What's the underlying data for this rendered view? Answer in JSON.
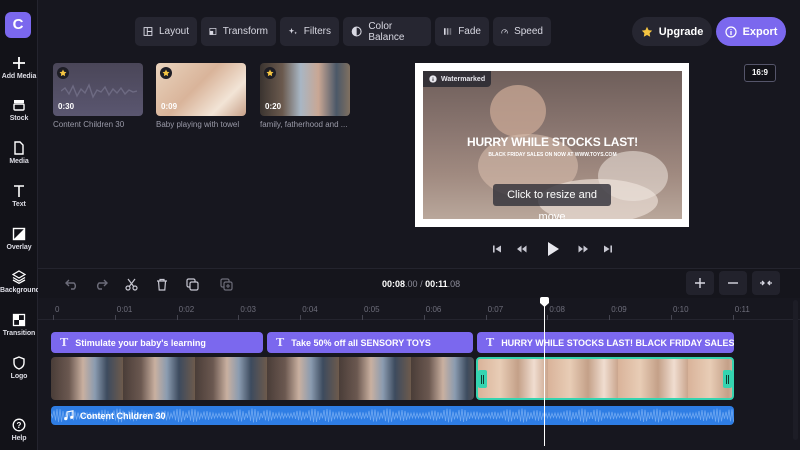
{
  "sidebar": {
    "logo": "C",
    "items": [
      {
        "label": "Add Media",
        "icon": "plus-icon"
      },
      {
        "label": "Stock",
        "icon": "stock-icon"
      },
      {
        "label": "Media",
        "icon": "file-icon"
      },
      {
        "label": "Text",
        "icon": "text-icon"
      },
      {
        "label": "Overlay",
        "icon": "overlay-icon"
      },
      {
        "label": "Background",
        "icon": "layers-icon"
      },
      {
        "label": "Transition",
        "icon": "transition-icon"
      },
      {
        "label": "Logo",
        "icon": "shield-icon"
      },
      {
        "label": "Help",
        "icon": "help-icon"
      }
    ]
  },
  "toolbar": {
    "layout": "Layout",
    "transform": "Transform",
    "filters": "Filters",
    "color_balance": "Color Balance",
    "fade": "Fade",
    "speed": "Speed",
    "upgrade": "Upgrade",
    "export": "Export"
  },
  "media": [
    {
      "name": "Content Children 30",
      "duration": "0:30"
    },
    {
      "name": "Baby playing with towel",
      "duration": "0:09"
    },
    {
      "name": "family, fatherhood and ...",
      "duration": "0:20"
    }
  ],
  "preview": {
    "aspect_ratio": "16:9",
    "watermark": "Watermarked",
    "headline": "HURRY WHILE STOCKS LAST!",
    "subline": "BLACK FRIDAY SALES ON NOW AT WWW.TOYS.COM",
    "hint": "Click to resize and move"
  },
  "timeline": {
    "current_time_main": "00:08",
    "current_time_frac": ".00",
    "separator": "/",
    "total_time_main": "00:11",
    "total_time_frac": ".08",
    "ruler": [
      "0",
      "0:01",
      "0:02",
      "0:03",
      "0:04",
      "0:05",
      "0:06",
      "0:07",
      "0:08",
      "0:09",
      "0:10",
      "0:11"
    ],
    "text_clips": [
      "Stimulate your baby's learning",
      "Take 50% off all SENSORY TOYS",
      "HURRY WHILE STOCKS LAST! BLACK FRIDAY SALES ON NOW AT WWW.TOYS.COM"
    ],
    "audio_clip": "Content Children 30"
  },
  "colors": {
    "accent": "#7b68ee",
    "selected_clip": "#35d4b0",
    "audio": "#2e7de4",
    "star": "#f5c542"
  }
}
